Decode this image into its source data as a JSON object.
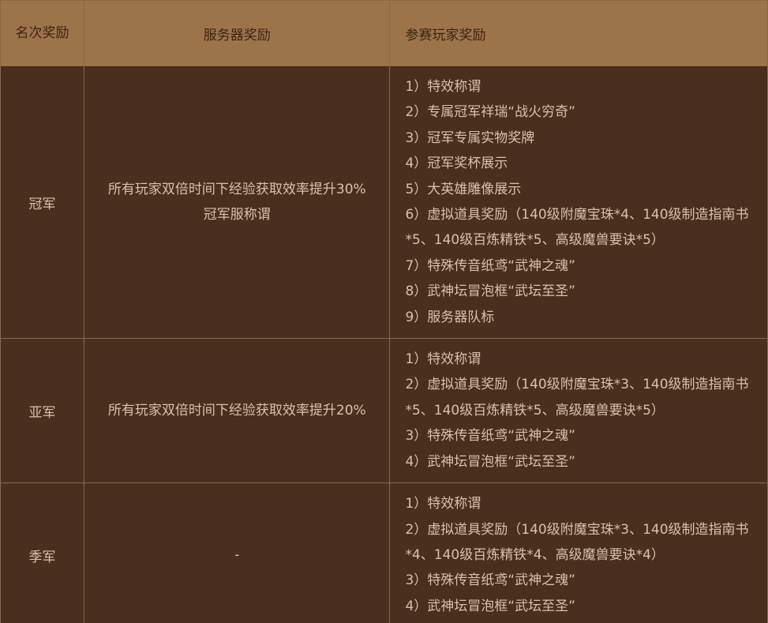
{
  "table": {
    "headers": {
      "rank": "名次奖励",
      "server_reward": "服务器奖励",
      "player_reward": "参赛玩家奖励"
    },
    "rows": [
      {
        "rank": "冠军",
        "server_reward": [
          "所有玩家双倍时间下经验获取效率提升30%",
          "冠军服称谓"
        ],
        "player_reward": [
          "1）特效称谓",
          "2）专属冠军祥瑞“战火穷奇”",
          "3）冠军专属实物奖牌",
          "4）冠军奖杯展示",
          "5）大英雄雕像展示",
          "6）虚拟道具奖励（140级附魔宝珠*4、140级制造指南书*5、140级百炼精铁*5、高级魔兽要诀*5）",
          "7）特殊传音纸鸢“武神之魂”",
          "8）武神坛冒泡框“武坛至圣”",
          "9）服务器队标"
        ]
      },
      {
        "rank": "亚军",
        "server_reward": [
          "所有玩家双倍时间下经验获取效率提升20%"
        ],
        "player_reward": [
          "1）特效称谓",
          "2）虚拟道具奖励（140级附魔宝珠*3、140级制造指南书*5、140级百炼精铁*5、高级魔兽要诀*5）",
          "3）特殊传音纸鸢“武神之魂”",
          "4）武神坛冒泡框“武坛至圣”"
        ]
      },
      {
        "rank": "季军",
        "server_reward": [
          "-"
        ],
        "player_reward": [
          "1）特效称谓",
          "2）虚拟道具奖励（140级附魔宝珠*3、140级制造指南书*4、140级百炼精铁*4、高级魔兽要诀*4）",
          "3）特殊传音纸鸢“武神之魂”",
          "4）武神坛冒泡框“武坛至圣”"
        ]
      }
    ]
  },
  "colors": {
    "header_bg": "#9d7449",
    "header_text": "#3a2415",
    "body_bg": "#4a2e1e",
    "body_text": "#d7c2a8",
    "border": "#8a6a4a"
  }
}
